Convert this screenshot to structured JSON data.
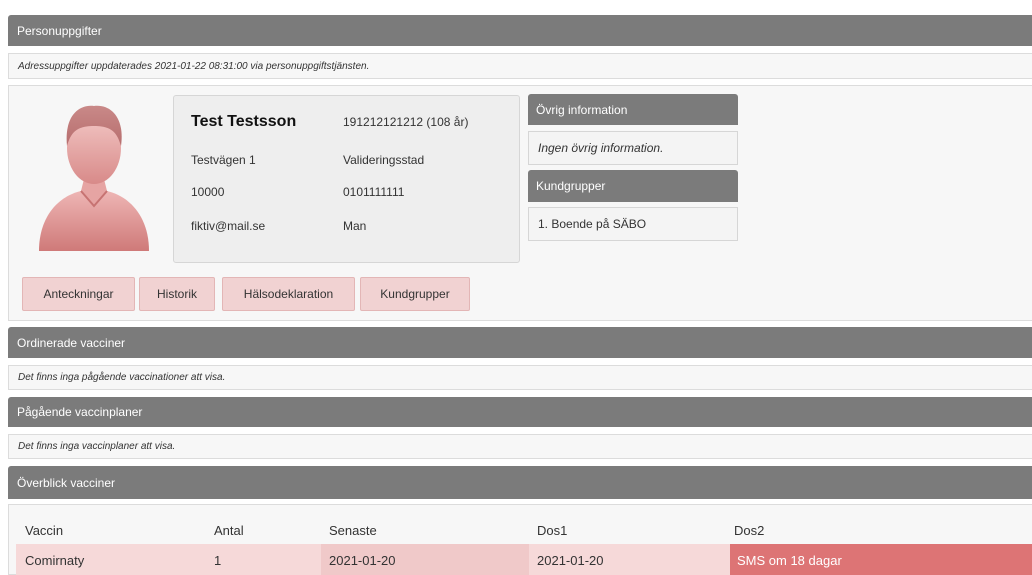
{
  "person_section": {
    "header": "Personuppgifter",
    "update_note": "Adressuppgifter uppdaterades 2021-01-22 08:31:00 via personuppgiftstjänsten."
  },
  "person": {
    "name": "Test Testsson",
    "personnummer": "191212121212 (108 år)",
    "address": "Testvägen 1",
    "city": "Valideringsstad",
    "postcode": "10000",
    "phone": "0101111111",
    "email": "fiktiv@mail.se",
    "gender": "Man"
  },
  "other_info": {
    "header": "Övrig information",
    "body": "Ingen övrig information."
  },
  "customer_groups": {
    "header": "Kundgrupper",
    "body": "1. Boende på SÄBO"
  },
  "buttons": {
    "notes": "Anteckningar",
    "history": "Historik",
    "health_declaration": "Hälsodeklaration",
    "customer_groups": "Kundgrupper"
  },
  "ordered_vaccines": {
    "header": "Ordinerade vacciner",
    "note": "Det finns inga pågående vaccinationer att visa."
  },
  "vaccine_plans": {
    "header": "Pågående vaccinplaner",
    "note": "Det finns inga vaccinplaner att visa."
  },
  "overview": {
    "header": "Överblick vacciner",
    "columns": [
      "Vaccin",
      "Antal",
      "Senaste",
      "Dos1",
      "Dos2"
    ],
    "rows": [
      {
        "vaccin": "Comirnaty",
        "antal": "1",
        "senaste": "2021-01-20",
        "dos1": "2021-01-20",
        "dos2": "SMS om 18 dagar"
      }
    ]
  },
  "colors": {
    "header_bg": "#7b7b7b",
    "button_bg": "#f1d2d2",
    "row_light": "#f6d9d9",
    "row_mid": "#f0c9c9",
    "row_alert": "#dd7475"
  }
}
